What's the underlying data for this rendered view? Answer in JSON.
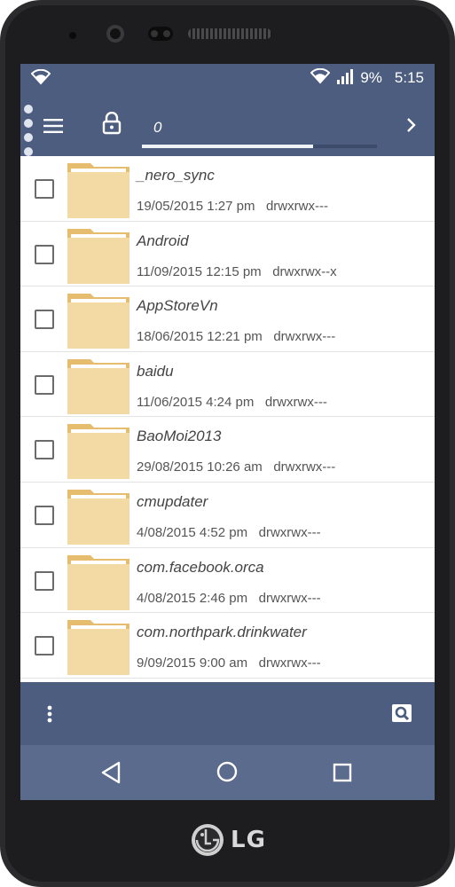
{
  "device": {
    "brand": "LG"
  },
  "status_bar": {
    "battery": "9%",
    "time": "5:15",
    "icons": [
      "wifi-icon",
      "wifi-icon",
      "signal-icon",
      "battery-icon"
    ]
  },
  "toolbar": {
    "path_label": "0",
    "progress_fraction": 0.73,
    "icons": [
      "menu-icon",
      "lock-icon",
      "chevron-right-icon"
    ]
  },
  "files": [
    {
      "name": "_nero_sync",
      "date": "19/05/2015 1:27 pm",
      "perms": "drwxrwx---"
    },
    {
      "name": "Android",
      "date": "11/09/2015 12:15 pm",
      "perms": "drwxrwx--x"
    },
    {
      "name": "AppStoreVn",
      "date": "18/06/2015 12:21 pm",
      "perms": "drwxrwx---"
    },
    {
      "name": "baidu",
      "date": "11/06/2015 4:24 pm",
      "perms": "drwxrwx---"
    },
    {
      "name": "BaoMoi2013",
      "date": "29/08/2015 10:26 am",
      "perms": "drwxrwx---"
    },
    {
      "name": "cmupdater",
      "date": "4/08/2015 4:52 pm",
      "perms": "drwxrwx---"
    },
    {
      "name": "com.facebook.orca",
      "date": "4/08/2015 2:46 pm",
      "perms": "drwxrwx---"
    },
    {
      "name": "com.northpark.drinkwater",
      "date": "9/09/2015 9:00 am",
      "perms": "drwxrwx---"
    }
  ],
  "bottom_bar": {
    "icons": [
      "more-vert-icon",
      "search-icon"
    ]
  },
  "nav_bar": {
    "icons": [
      "back-icon",
      "home-icon",
      "recents-icon"
    ]
  },
  "colors": {
    "bar": "#4d5d7f",
    "nav": "#5a6b8d",
    "folder": "#f3d9a4",
    "folder_tab": "#e6bd6e"
  }
}
